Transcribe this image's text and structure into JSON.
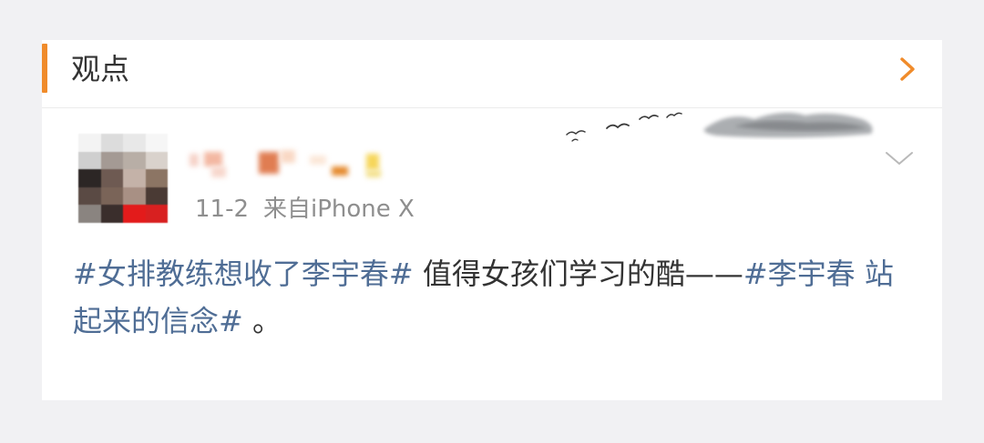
{
  "section": {
    "title": "观点",
    "arrow_icon": "chevron-right-icon",
    "accent_color": "#f08b2a"
  },
  "post": {
    "date": "11-2",
    "source": "来自iPhone X",
    "dropdown_icon": "chevron-down-icon",
    "content": {
      "tag1": "#女排教练想收了李宇春#",
      "text1": " 值得女孩们学习的酷——",
      "tag2": "#李宇春 站起来的信念#",
      "text2": " 。"
    },
    "tag_color": "#4f6d95"
  }
}
